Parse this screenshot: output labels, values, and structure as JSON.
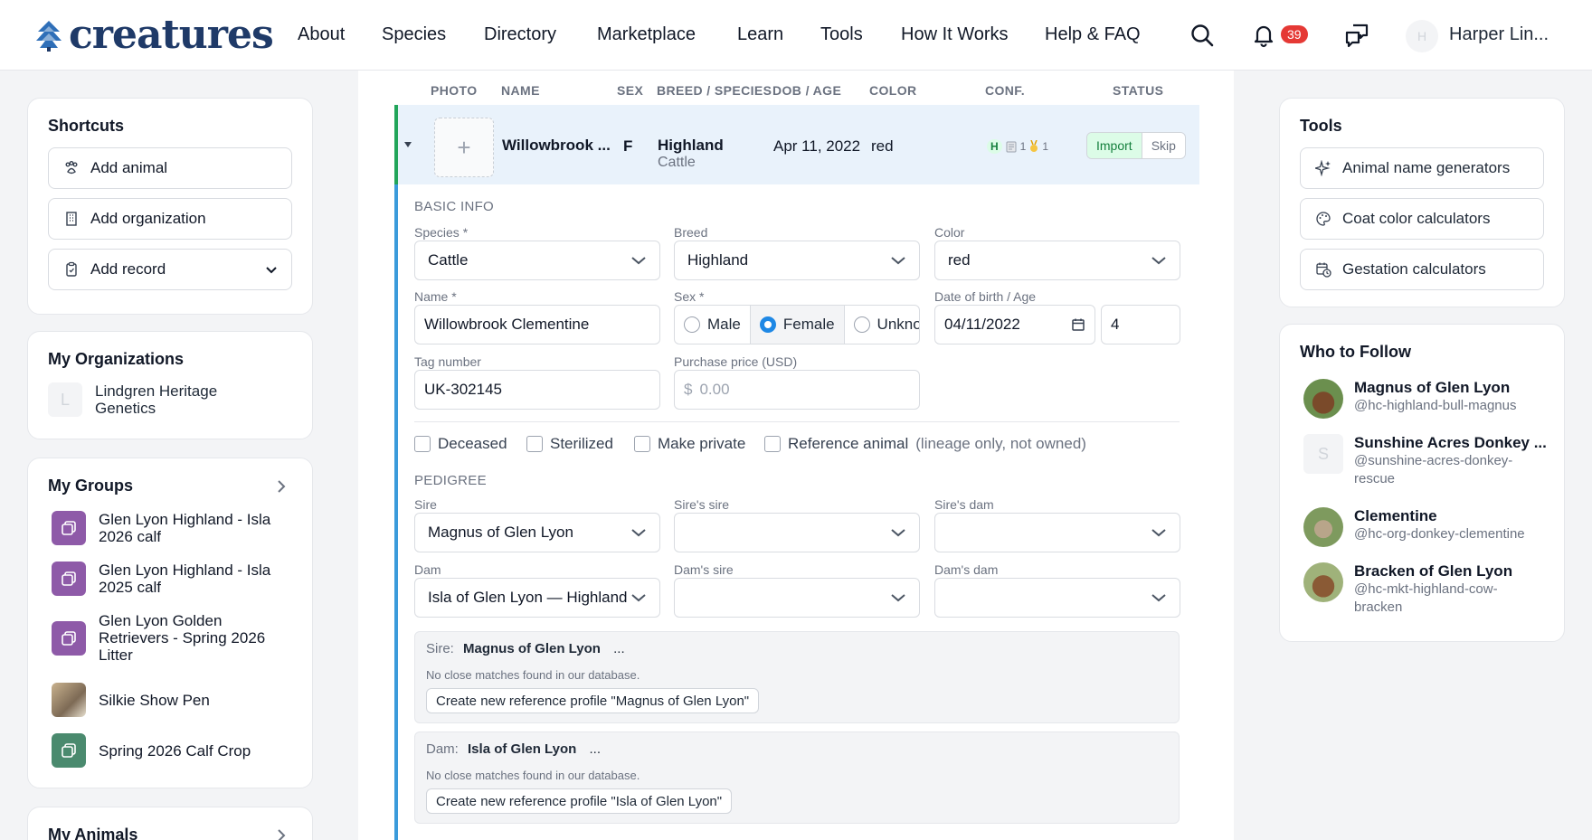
{
  "brand": {
    "name": "creatures",
    "color": "#1f3a68"
  },
  "nav": {
    "links": [
      "About",
      "Species",
      "Directory",
      "Marketplace",
      "Learn",
      "Tools",
      "How It Works",
      "Help & FAQ"
    ],
    "notifications_count": "39",
    "user_initial": "H",
    "user_name": "Harper Lin..."
  },
  "shortcuts": {
    "title": "Shortcuts",
    "items": [
      {
        "label": "Add animal",
        "icon": "paw-icon"
      },
      {
        "label": "Add organization",
        "icon": "building-icon"
      },
      {
        "label": "Add record",
        "icon": "clipboard-icon"
      }
    ]
  },
  "organizations": {
    "title": "My Organizations",
    "items": [
      {
        "initial": "L",
        "name": "Lindgren Heritage Genetics"
      }
    ]
  },
  "groups": {
    "title": "My Groups",
    "items": [
      {
        "name": "Glen Lyon Highland - Isla 2026 calf",
        "color": "#8e5aa8"
      },
      {
        "name": "Glen Lyon Highland - Isla 2025 calf",
        "color": "#8e5aa8"
      },
      {
        "name": "Glen Lyon Golden Retrievers - Spring 2026 Litter",
        "color": "#8e5aa8"
      },
      {
        "name": "Silkie Show Pen",
        "color": "#a98b6a"
      },
      {
        "name": "Spring 2026 Calf Crop",
        "color": "#4a8a6e"
      }
    ]
  },
  "animals_title": "My Animals",
  "table": {
    "headers": [
      "PHOTO",
      "NAME",
      "SEX",
      "BREED / SPECIES",
      "DOB / AGE",
      "COLOR",
      "CONF.",
      "STATUS"
    ],
    "row": {
      "name": "Willowbrook ...",
      "sex": "F",
      "breed": "Highland",
      "species": "Cattle",
      "dob": "Apr 11, 2022",
      "color": "red",
      "conf_h": "H",
      "conf_doc": "1",
      "conf_award": "1",
      "import_label": "Import",
      "skip_label": "Skip"
    }
  },
  "basic_info": {
    "title": "BASIC INFO",
    "species_label": "Species *",
    "species_value": "Cattle",
    "breed_label": "Breed",
    "breed_value": "Highland",
    "color_label": "Color",
    "color_value": "red",
    "name_label": "Name *",
    "name_value": "Willowbrook Clementine",
    "sex_label": "Sex *",
    "sex_options": [
      "Male",
      "Female",
      "Unknov"
    ],
    "sex_selected": "Female",
    "dob_label": "Date of birth / Age",
    "dob_value": "04/11/2022",
    "age_value": "4",
    "tag_label": "Tag number",
    "tag_value": "UK-302145",
    "price_label": "Purchase price (USD)",
    "price_symbol": "$",
    "price_placeholder": "0.00",
    "checkboxes": [
      "Deceased",
      "Sterilized",
      "Make private",
      "Reference animal"
    ],
    "reference_hint": "(lineage only, not owned)"
  },
  "pedigree": {
    "title": "PEDIGREE",
    "sire_label": "Sire",
    "sire_value": "Magnus of Glen Lyon",
    "sires_sire_label": "Sire's sire",
    "sires_dam_label": "Sire's dam",
    "dam_label": "Dam",
    "dam_value": "Isla of Glen Lyon — Highland",
    "dams_sire_label": "Dam's sire",
    "dams_dam_label": "Dam's dam",
    "sire_match": {
      "prefix": "Sire:",
      "name": "Magnus of Glen Lyon",
      "more": "...",
      "message": "No close matches found in our database.",
      "button": "Create new reference profile \"Magnus of Glen Lyon\""
    },
    "dam_match": {
      "prefix": "Dam:",
      "name": "Isla of Glen Lyon",
      "more": "...",
      "message": "No close matches found in our database.",
      "button": "Create new reference profile \"Isla of Glen Lyon\""
    }
  },
  "tools": {
    "title": "Tools",
    "items": [
      {
        "label": "Animal name generators",
        "icon": "sparkles-icon"
      },
      {
        "label": "Coat color calculators",
        "icon": "palette-icon"
      },
      {
        "label": "Gestation calculators",
        "icon": "calendar-clock-icon"
      }
    ]
  },
  "follow": {
    "title": "Who to Follow",
    "items": [
      {
        "name": "Magnus of Glen Lyon",
        "handle": "@hc-highland-bull-magnus"
      },
      {
        "name": "Sunshine Acres Donkey ...",
        "handle": "@sunshine-acres-donkey-rescue",
        "initial": "S"
      },
      {
        "name": "Clementine",
        "handle": "@hc-org-donkey-clementine"
      },
      {
        "name": "Bracken of Glen Lyon",
        "handle": "@hc-mkt-highland-cow-bracken"
      }
    ]
  }
}
